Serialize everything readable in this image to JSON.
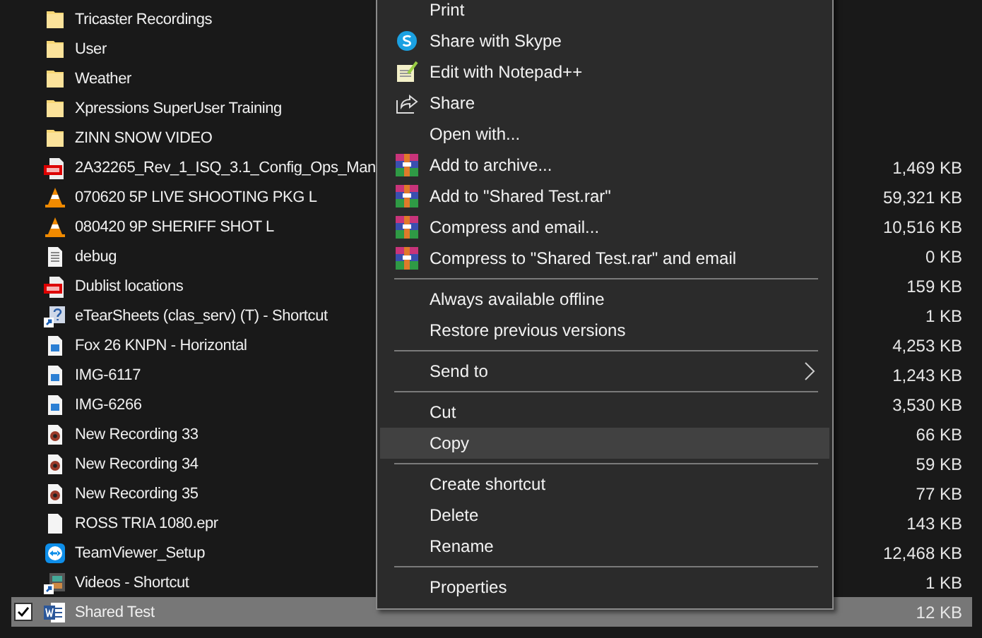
{
  "files": [
    {
      "name": "Tricaster Recordings",
      "selected": false
    },
    {
      "name": "User",
      "selected": false
    },
    {
      "name": "Weather",
      "selected": false
    },
    {
      "name": "Xpressions SuperUser Training",
      "selected": false
    },
    {
      "name": "ZINN SNOW VIDEO",
      "selected": false
    },
    {
      "name": "2A32265_Rev_1_ISQ_3.1_Config_Ops_Man",
      "size": "1,469 KB",
      "selected": false
    },
    {
      "name": "070620 5P LIVE SHOOTING PKG L",
      "size": "59,321 KB",
      "selected": false
    },
    {
      "name": "080420 9P SHERIFF SHOT L",
      "size": "10,516 KB",
      "selected": false
    },
    {
      "name": "debug",
      "size": "0 KB",
      "selected": false
    },
    {
      "name": "Dublist locations",
      "size": "159 KB",
      "selected": false
    },
    {
      "name": "eTearSheets (clas_serv) (T) - Shortcut",
      "size": "1 KB",
      "selected": false
    },
    {
      "name": "Fox 26 KNPN - Horizontal",
      "size": "4,253 KB",
      "selected": false
    },
    {
      "name": "IMG-6117",
      "size": "1,243 KB",
      "selected": false
    },
    {
      "name": "IMG-6266",
      "size": "3,530 KB",
      "selected": false
    },
    {
      "name": "New Recording 33",
      "size": "66 KB",
      "selected": false
    },
    {
      "name": "New Recording 34",
      "size": "59 KB",
      "selected": false
    },
    {
      "name": "New Recording 35",
      "size": "77 KB",
      "selected": false
    },
    {
      "name": "ROSS TRIA 1080.epr",
      "size": "143 KB",
      "selected": false
    },
    {
      "name": "TeamViewer_Setup",
      "size": "12,468 KB",
      "selected": false
    },
    {
      "name": "Videos - Shortcut",
      "size": "1 KB",
      "selected": false
    },
    {
      "name": "Shared Test",
      "size": "12 KB",
      "selected": true,
      "checked": true
    }
  ],
  "context_menu": {
    "groups": [
      [
        {
          "label": "Print",
          "highlighted": false,
          "submenu": false
        },
        {
          "label": "Share with Skype",
          "highlighted": false,
          "submenu": false
        },
        {
          "label": "Edit with Notepad++",
          "highlighted": false,
          "submenu": false
        },
        {
          "label": "Share",
          "highlighted": false,
          "submenu": false
        },
        {
          "label": "Open with...",
          "highlighted": false,
          "submenu": false
        },
        {
          "label": "Add to archive...",
          "highlighted": false,
          "submenu": false
        },
        {
          "label": "Add to \"Shared Test.rar\"",
          "highlighted": false,
          "submenu": false
        },
        {
          "label": "Compress and email...",
          "highlighted": false,
          "submenu": false
        },
        {
          "label": "Compress to \"Shared Test.rar\" and email",
          "highlighted": false,
          "submenu": false
        }
      ],
      [
        {
          "label": "Always available offline",
          "highlighted": false,
          "submenu": false
        },
        {
          "label": "Restore previous versions",
          "highlighted": false,
          "submenu": false
        }
      ],
      [
        {
          "label": "Send to",
          "highlighted": false,
          "submenu": true
        }
      ],
      [
        {
          "label": "Cut",
          "highlighted": false,
          "submenu": false
        },
        {
          "label": "Copy",
          "highlighted": true,
          "submenu": false
        }
      ],
      [
        {
          "label": "Create shortcut",
          "highlighted": false,
          "submenu": false
        },
        {
          "label": "Delete",
          "highlighted": false,
          "submenu": false
        },
        {
          "label": "Rename",
          "highlighted": false,
          "submenu": false
        }
      ],
      [
        {
          "label": "Properties",
          "highlighted": false,
          "submenu": false
        }
      ]
    ]
  }
}
